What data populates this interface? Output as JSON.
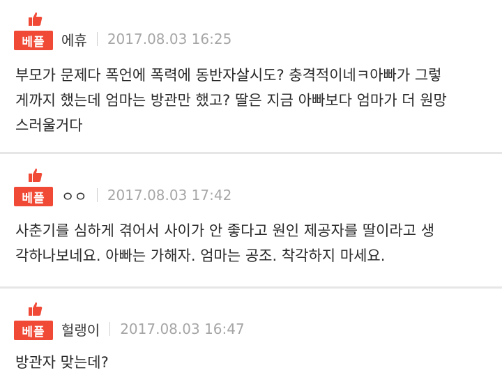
{
  "badge_label": "베플",
  "comments": [
    {
      "nickname": "에휴",
      "date": "2017.08.03 16:25",
      "lines": [
        "부모가 문제다 폭언에 폭력에 동반자살시도? 충격적이네ㅋ아빠가 그렇",
        "게까지 했는데 엄마는 방관만 했고? 딸은 지금 아빠보다 엄마가 더 원망",
        "스러울거다"
      ]
    },
    {
      "nickname": "ㅇㅇ",
      "date": "2017.08.03 17:42",
      "lines": [
        "사춘기를 심하게 겪어서 사이가 안 좋다고 원인 제공자를 딸이라고 생",
        "각하나보네요. 아빠는 가해자. 엄마는 공조. 착각하지 마세요."
      ]
    },
    {
      "nickname": "헐랭이",
      "date": "2017.08.03 16:47",
      "lines": [
        "방관자 맞는데?"
      ]
    }
  ],
  "colors": {
    "badge": "#f04a37",
    "date": "#a6a6a6",
    "separator": "#e6e6e6"
  },
  "icons": {
    "thumb": "thumbs-up-icon"
  }
}
